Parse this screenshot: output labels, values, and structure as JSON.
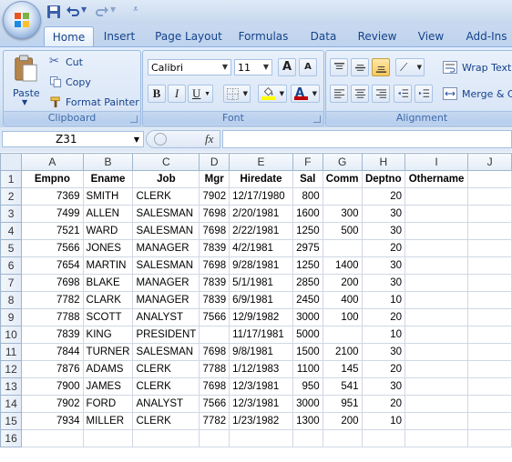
{
  "qat": {
    "icons": [
      "save-icon",
      "undo-icon",
      "redo-icon",
      "customize-icon"
    ]
  },
  "tabs": [
    "Home",
    "Insert",
    "Page Layout",
    "Formulas",
    "Data",
    "Review",
    "View",
    "Add-Ins"
  ],
  "active_tab": "Home",
  "clipboard": {
    "paste": "Paste",
    "cut": "Cut",
    "copy": "Copy",
    "format_painter": "Format Painter",
    "label": "Clipboard"
  },
  "font": {
    "name": "Calibri",
    "size": "11",
    "grow": "A",
    "shrink": "A",
    "bold": "B",
    "italic": "I",
    "underline": "U",
    "color_letter": "A",
    "label": "Font",
    "fill_color": "#ffff00",
    "font_color": "#c00000"
  },
  "alignment": {
    "wrap_text": "Wrap Text",
    "merge": "Merge & C",
    "label": "Alignment"
  },
  "formula_bar": {
    "name_box": "Z31",
    "fx": "fx",
    "value": ""
  },
  "sheet": {
    "columns": [
      "A",
      "B",
      "C",
      "D",
      "E",
      "F",
      "G",
      "H",
      "I",
      "J"
    ],
    "rows": [
      [
        "Empno",
        "Ename",
        "Job",
        "Mgr",
        "Hiredate",
        "Sal",
        "Comm",
        "Deptno",
        "Othername",
        ""
      ],
      [
        "7369",
        "SMITH",
        "CLERK",
        "7902",
        "12/17/1980",
        "800",
        "",
        "20",
        "",
        ""
      ],
      [
        "7499",
        "ALLEN",
        "SALESMAN",
        "7698",
        "2/20/1981",
        "1600",
        "300",
        "30",
        "",
        ""
      ],
      [
        "7521",
        "WARD",
        "SALESMAN",
        "7698",
        "2/22/1981",
        "1250",
        "500",
        "30",
        "",
        ""
      ],
      [
        "7566",
        "JONES",
        "MANAGER",
        "7839",
        "4/2/1981",
        "2975",
        "",
        "20",
        "",
        ""
      ],
      [
        "7654",
        "MARTIN",
        "SALESMAN",
        "7698",
        "9/28/1981",
        "1250",
        "1400",
        "30",
        "",
        ""
      ],
      [
        "7698",
        "BLAKE",
        "MANAGER",
        "7839",
        "5/1/1981",
        "2850",
        "200",
        "30",
        "",
        ""
      ],
      [
        "7782",
        "CLARK",
        "MANAGER",
        "7839",
        "6/9/1981",
        "2450",
        "400",
        "10",
        "",
        ""
      ],
      [
        "7788",
        "SCOTT",
        "ANALYST",
        "7566",
        "12/9/1982",
        "3000",
        "100",
        "20",
        "",
        ""
      ],
      [
        "7839",
        "KING",
        "PRESIDENT",
        "",
        "11/17/1981",
        "5000",
        "",
        "10",
        "",
        ""
      ],
      [
        "7844",
        "TURNER",
        "SALESMAN",
        "7698",
        "9/8/1981",
        "1500",
        "2100",
        "30",
        "",
        ""
      ],
      [
        "7876",
        "ADAMS",
        "CLERK",
        "7788",
        "1/12/1983",
        "1100",
        "145",
        "20",
        "",
        ""
      ],
      [
        "7900",
        "JAMES",
        "CLERK",
        "7698",
        "12/3/1981",
        "950",
        "541",
        "30",
        "",
        ""
      ],
      [
        "7902",
        "FORD",
        "ANALYST",
        "7566",
        "12/3/1981",
        "3000",
        "951",
        "20",
        "",
        ""
      ],
      [
        "7934",
        "MILLER",
        "CLERK",
        "7782",
        "1/23/1982",
        "1300",
        "200",
        "10",
        "",
        ""
      ],
      [
        "",
        "",
        "",
        "",
        "",
        "",
        "",
        "",
        "",
        ""
      ]
    ],
    "row_numbers": [
      "1",
      "2",
      "3",
      "4",
      "5",
      "6",
      "7",
      "8",
      "9",
      "10",
      "11",
      "12",
      "13",
      "14",
      "15",
      "16"
    ]
  }
}
